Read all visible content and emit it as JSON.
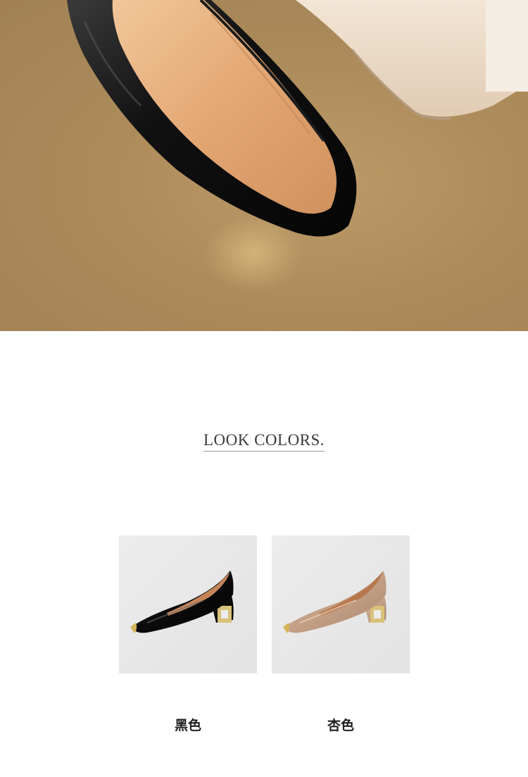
{
  "hero": {
    "alt": "black patent pump on carpet",
    "colors": {
      "carpet": "#a8875a",
      "patent": "#161616",
      "lining": "#e0a878",
      "nude": "#ecdccb"
    }
  },
  "section": {
    "title": "LOOK COLORS."
  },
  "swatches": [
    {
      "label": "黑色",
      "color": "#141414",
      "icon": "black-pump-image"
    },
    {
      "label": "杏色",
      "color": "#c8a68c",
      "icon": "apricot-pump-image"
    }
  ]
}
